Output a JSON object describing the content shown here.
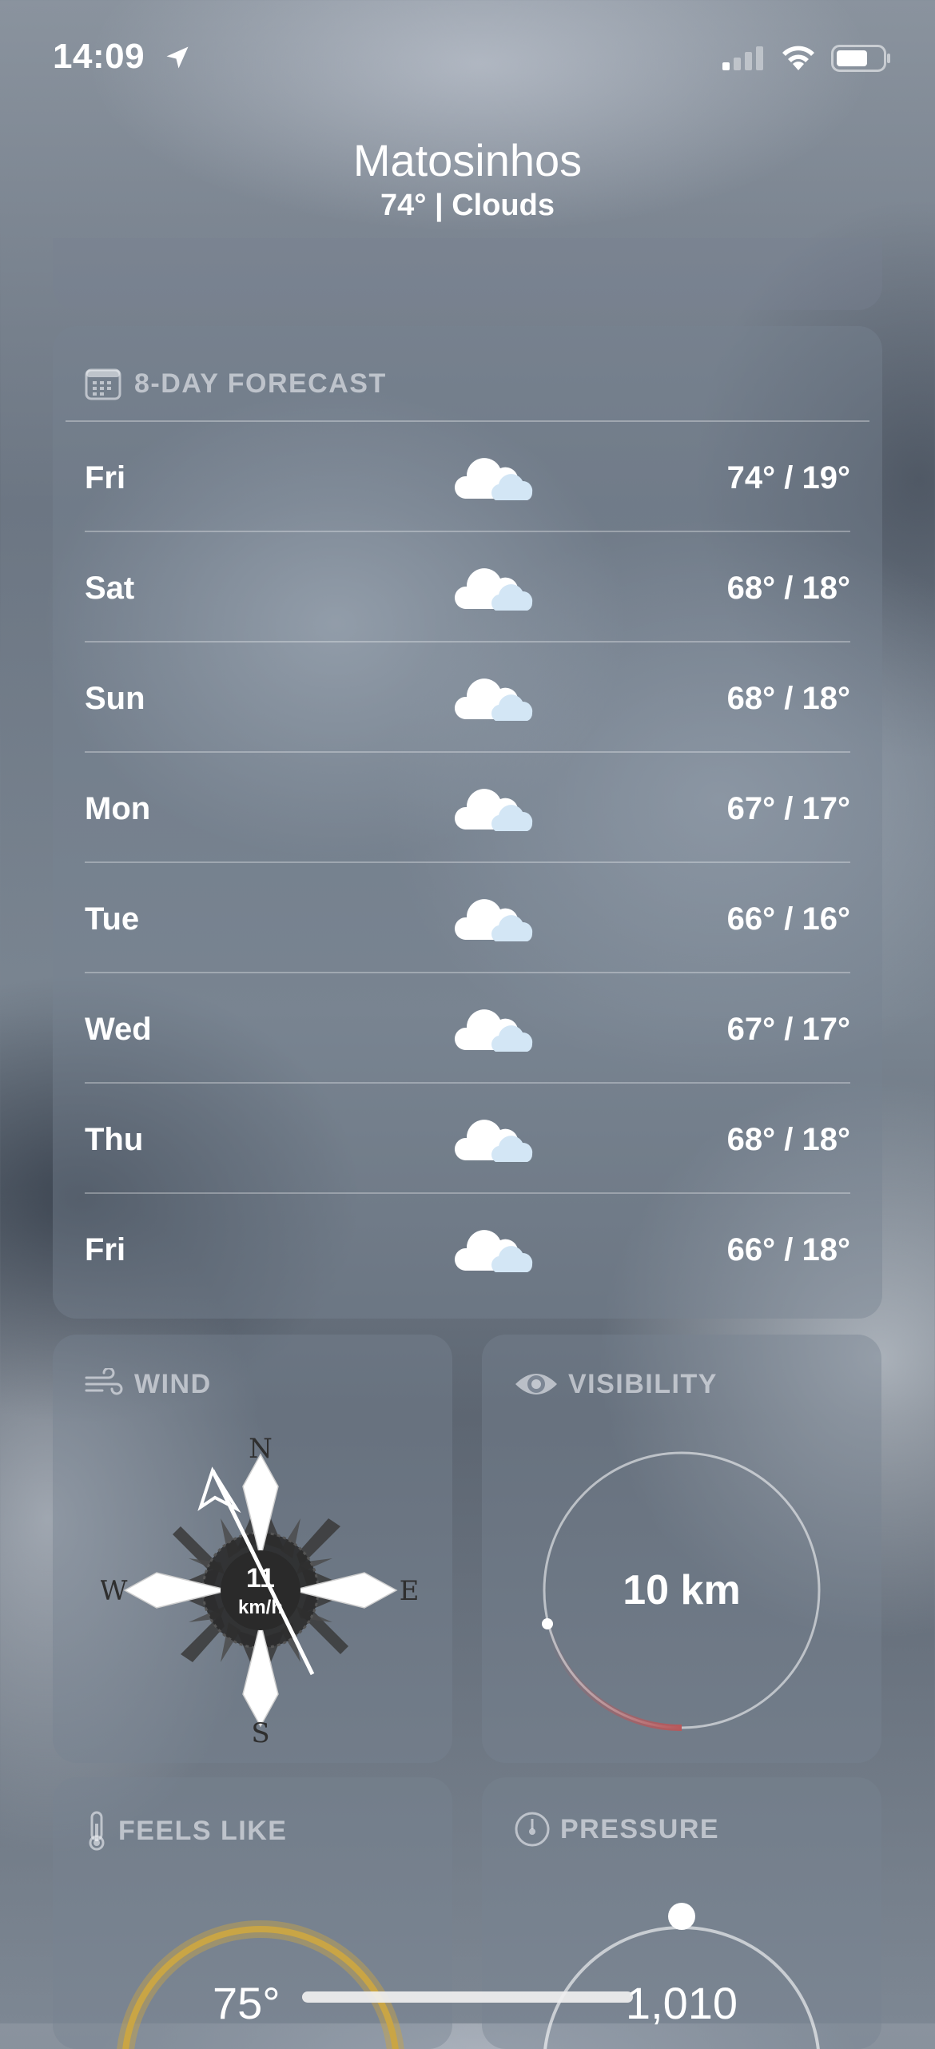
{
  "status_bar": {
    "time": "14:09",
    "icons": [
      "location-arrow-icon",
      "cellular-signal-icon",
      "wifi-icon",
      "battery-icon"
    ]
  },
  "header": {
    "city": "Matosinhos",
    "summary": "74° | Clouds"
  },
  "forecast": {
    "title": "8-DAY FORECAST",
    "icon": "calendar-icon",
    "days": [
      {
        "day": "Fri",
        "temps": "74° / 19°",
        "icon": "cloud-icon"
      },
      {
        "day": "Sat",
        "temps": "68° / 18°",
        "icon": "cloud-icon"
      },
      {
        "day": "Sun",
        "temps": "68° / 18°",
        "icon": "cloud-icon"
      },
      {
        "day": "Mon",
        "temps": "67° / 17°",
        "icon": "cloud-icon"
      },
      {
        "day": "Tue",
        "temps": "66° / 16°",
        "icon": "cloud-icon"
      },
      {
        "day": "Wed",
        "temps": "67° / 17°",
        "icon": "cloud-icon"
      },
      {
        "day": "Thu",
        "temps": "68° / 18°",
        "icon": "cloud-icon"
      },
      {
        "day": "Fri",
        "temps": "66° / 18°",
        "icon": "cloud-icon"
      }
    ]
  },
  "wind": {
    "title": "WIND",
    "icon": "wind-icon",
    "speed": "11",
    "unit": "km/h",
    "compass": {
      "n": "N",
      "s": "S",
      "e": "E",
      "w": "W"
    }
  },
  "visibility": {
    "title": "VISIBILITY",
    "icon": "eye-icon",
    "value": "10 km"
  },
  "feels_like": {
    "title": "FEELS LIKE",
    "icon": "thermometer-icon",
    "value": "75°"
  },
  "pressure": {
    "title": "PRESSURE",
    "icon": "gauge-icon",
    "value": "1,010"
  },
  "colors": {
    "card_bg": "#7d8796",
    "visibility_arc": "#b8575a",
    "feels_gauge": "#c9a545",
    "text_muted": "#dfe3e8"
  }
}
